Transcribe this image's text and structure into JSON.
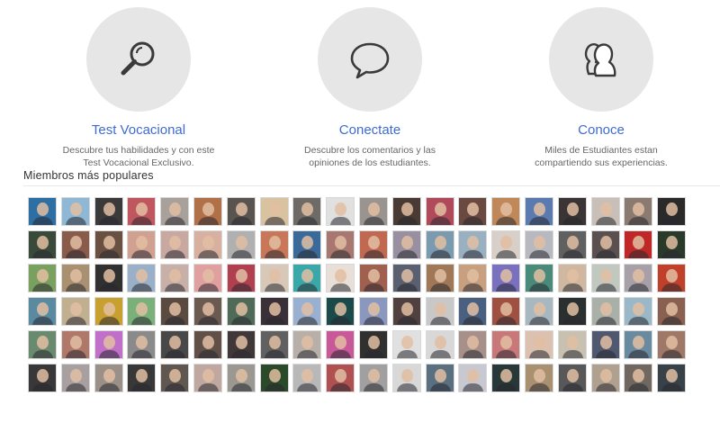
{
  "features": [
    {
      "icon": "magnifier-icon",
      "title": "Test Vocacional",
      "description_line1": "Descubre tus habilidades y con este",
      "description_line2": "Test Vocacional Exclusivo."
    },
    {
      "icon": "speech-bubble-icon",
      "title": "Conectate",
      "description_line1": "Descubre los comentarios y las",
      "description_line2": "opiniones de los estudiantes."
    },
    {
      "icon": "people-icon",
      "title": "Conoce",
      "description_line1": "Miles de Estudiantes estan",
      "description_line2": "compartiendo sus experiencias."
    }
  ],
  "members": {
    "title": "Miembros más populares",
    "rows": 6,
    "columns": 20,
    "avatar_colors": [
      "#2d6fa3",
      "#8fb8d6",
      "#3a3a3a",
      "#c0565e",
      "#a8a09a",
      "#b07048",
      "#5a5450",
      "#d9c2a0",
      "#6e6a66",
      "#e0e0e0",
      "#9a9490",
      "#4a3a34",
      "#b04a5a",
      "#6a4a40",
      "#c08858",
      "#5a7ab0",
      "#3a3434",
      "#c8c0b8",
      "#8a7a70",
      "#2a2a2a",
      "#3a4a3a",
      "#8a5a4a",
      "#6a5040",
      "#d0a090",
      "#c8a8a0",
      "#d8b0a0",
      "#b0b0b0",
      "#c87858",
      "#3a6a9a",
      "#a87870",
      "#c06850",
      "#9890a0",
      "#7a9ab0",
      "#98b0c0",
      "#d8d0c8",
      "#b8b8c0",
      "#606060",
      "#5a5050",
      "#c02828",
      "#2a3a2a",
      "#7aa060",
      "#a89070",
      "#303030",
      "#9ab0c8",
      "#c8b0a8",
      "#e0a0a0",
      "#b04050",
      "#d8c8b8",
      "#3aa8a8",
      "#e8e0d8",
      "#a06050",
      "#5a6070",
      "#a07858",
      "#c8a080",
      "#7a70c0",
      "#4a8a7a",
      "#d0b8a0",
      "#c0c8c0",
      "#a8a0a8",
      "#c0402a",
      "#5a8aa0",
      "#c0b090",
      "#c8a030",
      "#7ab07a",
      "#5a4a40",
      "#6a5a50",
      "#506a58",
      "#3a3038",
      "#9ab0d0",
      "#1a4a4a",
      "#8a98c0",
      "#504040",
      "#c8c8c8",
      "#4a6080",
      "#a05040",
      "#a8b8c0",
      "#2a3030",
      "#a8b0a8",
      "#9ab8c8",
      "#8a6050",
      "#6a8a70",
      "#b0786a",
      "#c070c8",
      "#8a8a8a",
      "#484848",
      "#605048",
      "#403838",
      "#606060",
      "#b8b0a8",
      "#c85898",
      "#303030",
      "#e0e0e0",
      "#d8d8d8",
      "#a8908a",
      "#c87878",
      "#dcc0b0",
      "#c8c0b0",
      "#505870",
      "#6a8aa0",
      "#a07868",
      "#383838",
      "#a8a0a0",
      "#9a9088",
      "#383838",
      "#605850",
      "#c0a8a0",
      "#9a9890",
      "#2a4a2a",
      "#b8b8b8",
      "#b05050",
      "#a0a0a0",
      "#d8d8d8",
      "#5a7080",
      "#c8c8d0",
      "#283838",
      "#a89070",
      "#585858",
      "#b0a090",
      "#706860",
      "#384048"
    ]
  }
}
